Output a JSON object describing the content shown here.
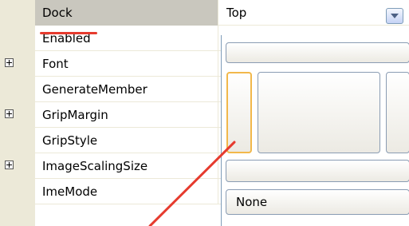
{
  "properties": [
    {
      "name": "Dock",
      "value": "Top",
      "expandable": false,
      "selected": true
    },
    {
      "name": "Enabled",
      "value": "",
      "expandable": false,
      "selected": false
    },
    {
      "name": "Font",
      "value": "",
      "expandable": true,
      "selected": false
    },
    {
      "name": "GenerateMember",
      "value": "",
      "expandable": false,
      "selected": false
    },
    {
      "name": "GripMargin",
      "value": "",
      "expandable": true,
      "selected": false
    },
    {
      "name": "GripStyle",
      "value": "",
      "expandable": false,
      "selected": false
    },
    {
      "name": "ImageScalingSize",
      "value": "",
      "expandable": true,
      "selected": false
    },
    {
      "name": "ImeMode",
      "value": "",
      "expandable": false,
      "selected": false
    }
  ],
  "dock_editor": {
    "none_label": "None"
  },
  "colors": {
    "annotation": "#e63b2e",
    "focus": "#f2b84b",
    "gutter": "#ece9d8"
  }
}
